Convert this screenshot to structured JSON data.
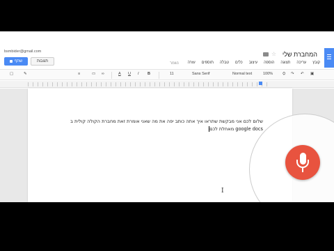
{
  "header": {
    "account_email": "bsmbider@gmail.com",
    "doc_title": "המחברת שלי",
    "share_label": "שתף",
    "comments_label": "תגובות",
    "edit_status": "נשמר"
  },
  "menu": [
    "קובץ",
    "עריכה",
    "תצוגה",
    "הוספה",
    "עיצוב",
    "כלים",
    "טבלה",
    "תוספים",
    "עזרה"
  ],
  "toolbar": {
    "zoom": "100%",
    "style": "Normal text",
    "font": "Sans Serif",
    "size": "11"
  },
  "document": {
    "line1": "שלום לכם אני מבקשת שתראו איך אתה כותב יפה את מה שאני אומרת זאת מחברת הקולה קולית ב",
    "line2": "google docs מאחלת לכם"
  },
  "colors": {
    "accent": "#4a8af4",
    "mic": "#e8533f"
  },
  "icons": [
    "star-icon",
    "folder-icon",
    "docs-logo-icon",
    "lock-icon",
    "print-icon",
    "undo-icon",
    "redo-icon",
    "paint-format-icon",
    "microphone-icon",
    "bold-icon",
    "italic-icon",
    "underline-icon",
    "text-color-icon",
    "link-icon",
    "comment-icon",
    "pen-icon"
  ]
}
